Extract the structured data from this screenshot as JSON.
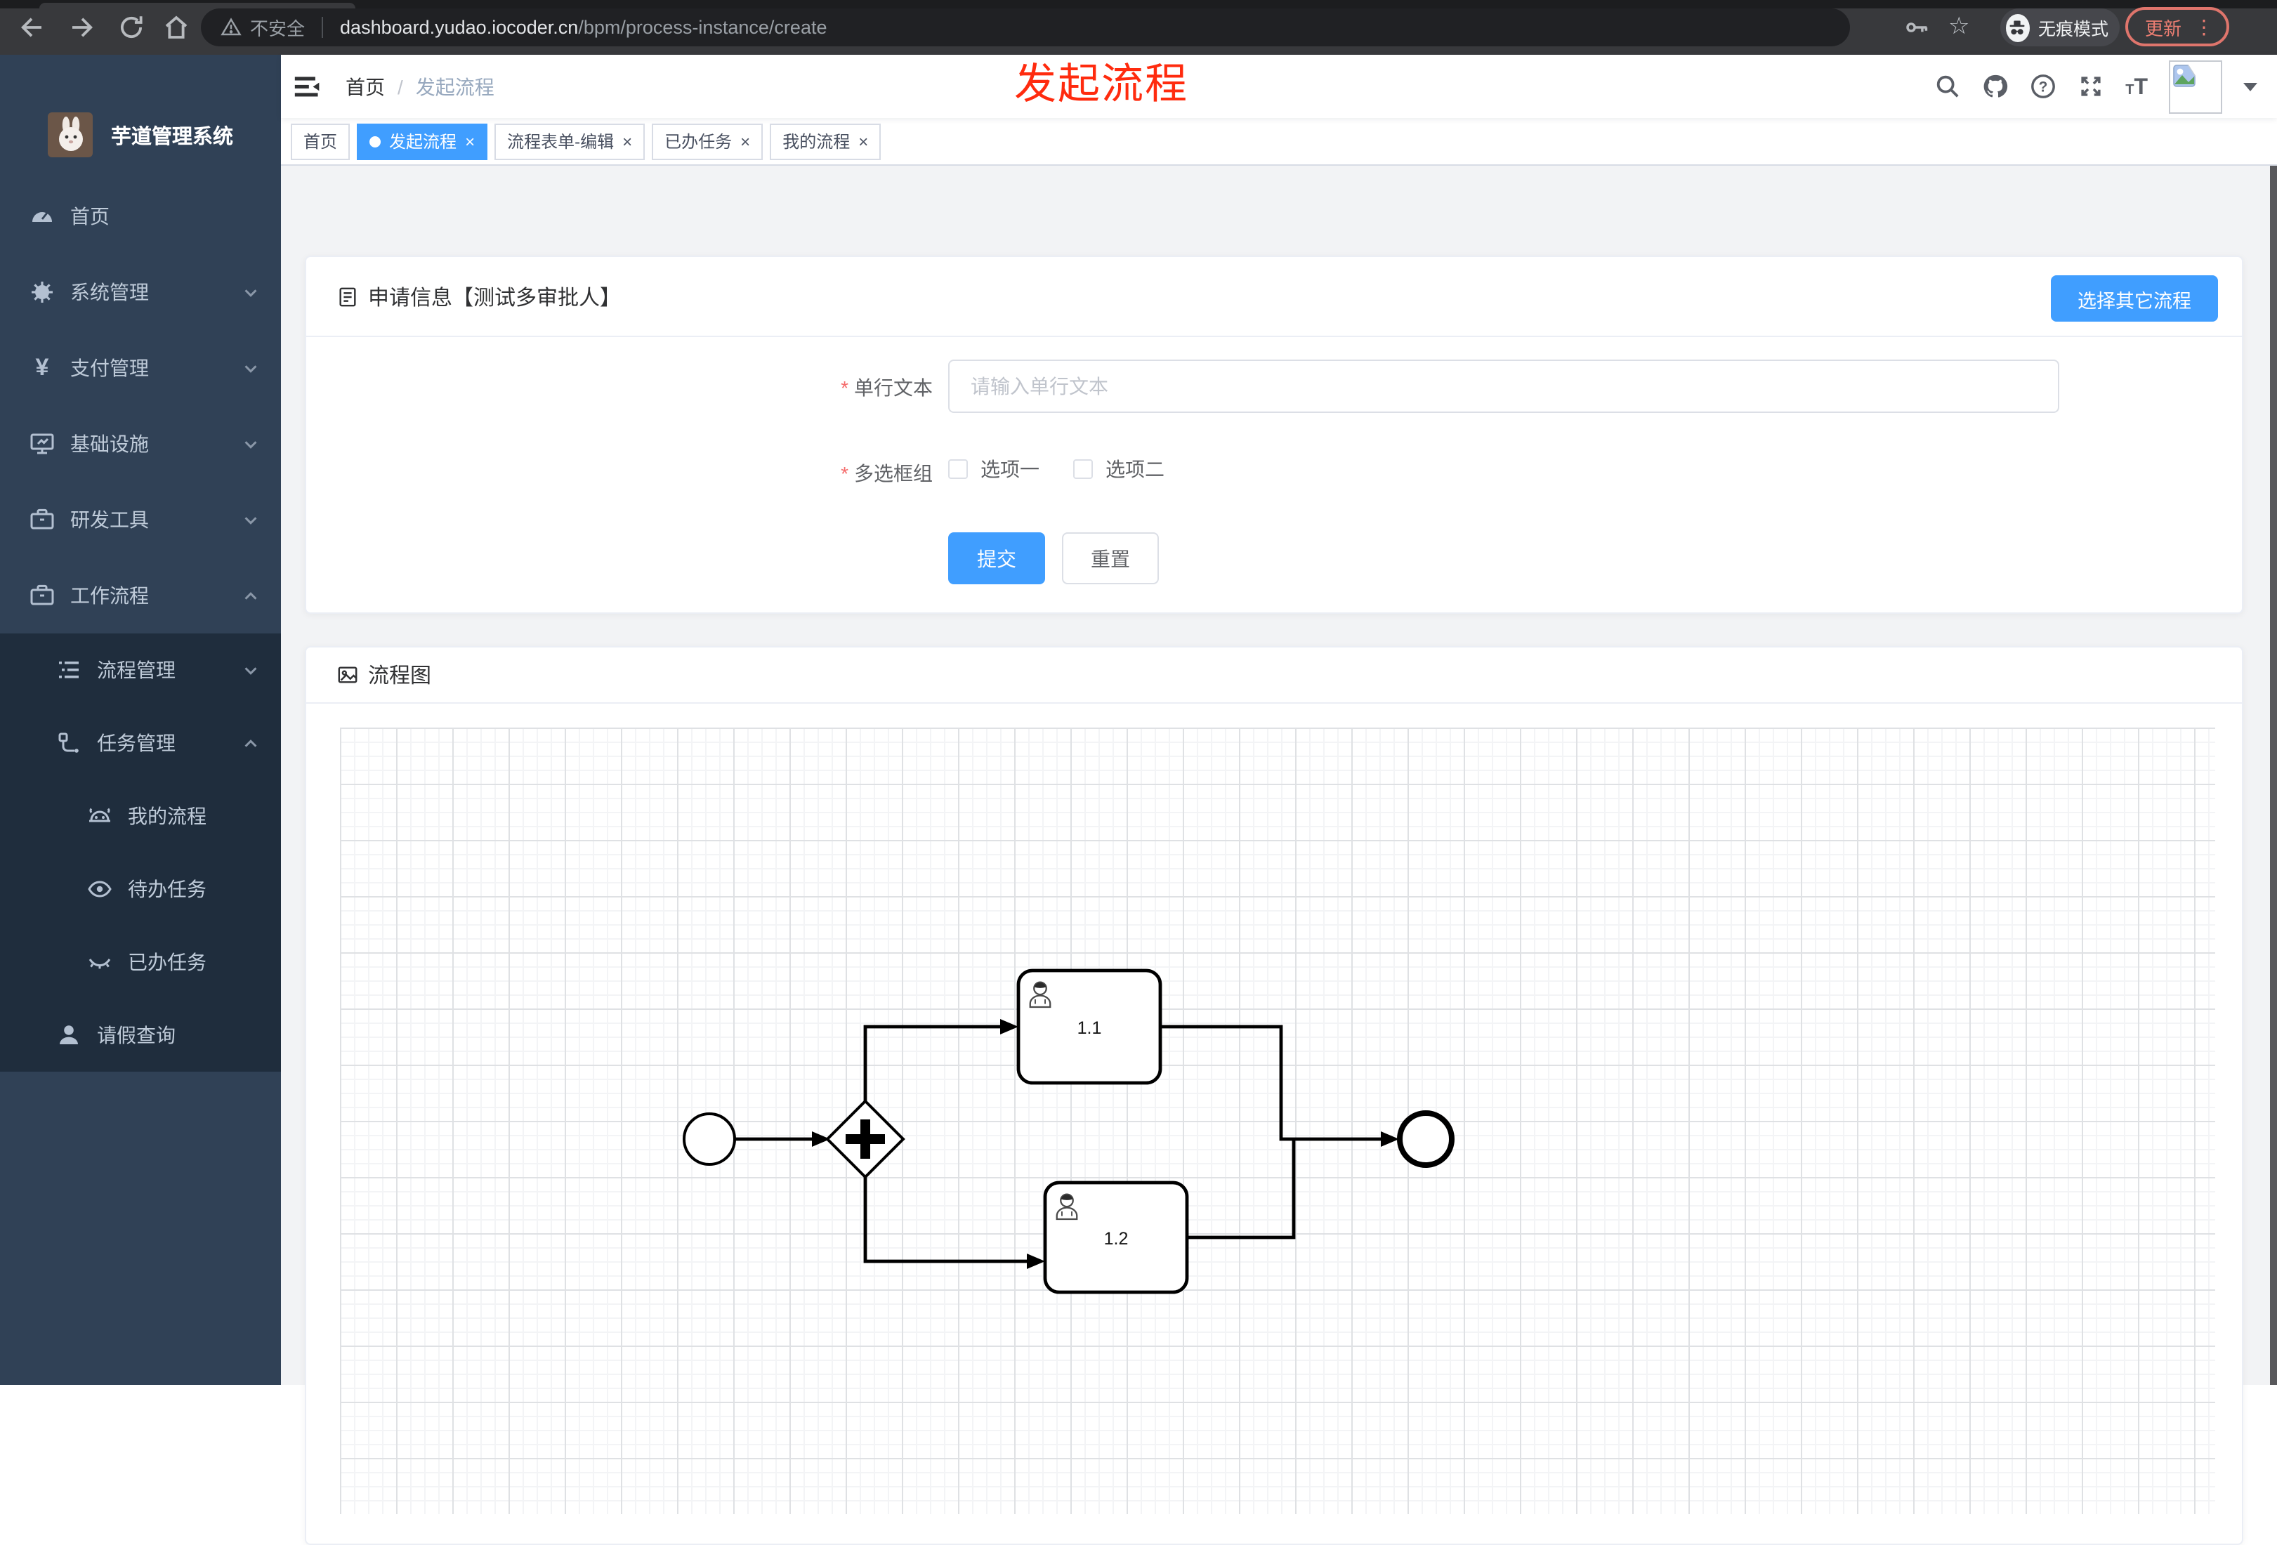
{
  "browser": {
    "security_label": "不安全",
    "url_domain": "dashboard.yudao.iocoder.cn",
    "url_path": "/bpm/process-instance/create",
    "incognito_label": "无痕模式",
    "update_label": "更新"
  },
  "annotation": {
    "text": "发起流程",
    "color": "#ff2b0e"
  },
  "sidebar": {
    "title": "芋道管理系统",
    "items": [
      {
        "label": "首页"
      },
      {
        "label": "系统管理"
      },
      {
        "label": "支付管理"
      },
      {
        "label": "基础设施"
      },
      {
        "label": "研发工具"
      },
      {
        "label": "工作流程"
      }
    ],
    "submenu": [
      {
        "label": "流程管理"
      },
      {
        "label": "任务管理"
      },
      {
        "label": "我的流程"
      },
      {
        "label": "待办任务"
      },
      {
        "label": "已办任务"
      },
      {
        "label": "请假查询"
      }
    ]
  },
  "navbar": {
    "breadcrumb": [
      "首页",
      "发起流程"
    ],
    "separator": "/"
  },
  "tabs": [
    {
      "label": "首页"
    },
    {
      "label": "发起流程"
    },
    {
      "label": "流程表单-编辑"
    },
    {
      "label": "已办任务"
    },
    {
      "label": "我的流程"
    }
  ],
  "form_card": {
    "title": "申请信息【测试多审批人】",
    "choose_other_button": "选择其它流程",
    "required_mark": "*",
    "text_field": {
      "label": "单行文本",
      "placeholder": "请输入单行文本"
    },
    "checkbox_field": {
      "label": "多选框组",
      "options": [
        "选项一",
        "选项二"
      ]
    },
    "submit_button": "提交",
    "reset_button": "重置"
  },
  "flow_card": {
    "title": "流程图",
    "tasks": [
      "1.1",
      "1.2"
    ]
  },
  "glyphs": {
    "close": "×",
    "dots": "⋮",
    "star": "☆",
    "yen": "¥",
    "question": "?",
    "t": "T"
  },
  "colors": {
    "accent": "#409eff",
    "sidebar_bg": "#304156",
    "submenu_bg": "#1f2d3d",
    "annotation": "#ff2b0e"
  }
}
